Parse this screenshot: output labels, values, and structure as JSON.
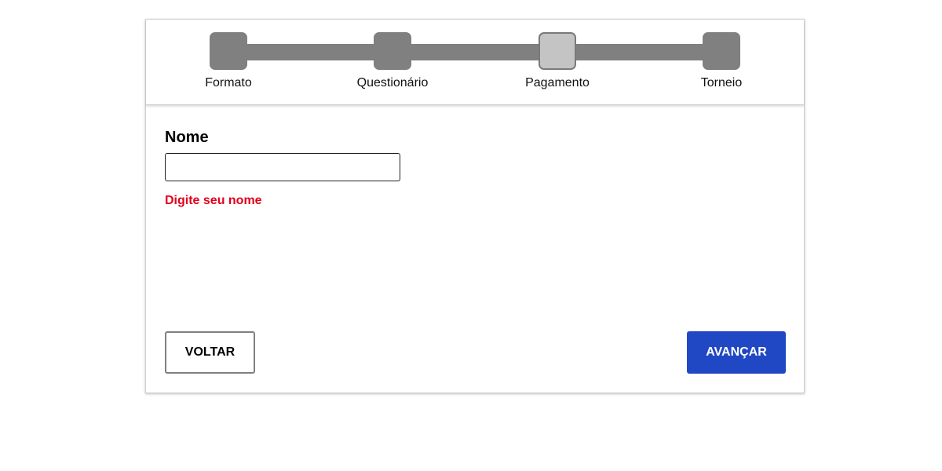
{
  "stepper": {
    "steps": [
      {
        "label": "Formato",
        "state": "done"
      },
      {
        "label": "Questionário",
        "state": "done"
      },
      {
        "label": "Pagamento",
        "state": "current"
      },
      {
        "label": "Torneio",
        "state": "pending"
      }
    ]
  },
  "form": {
    "name_label": "Nome",
    "name_value": "",
    "name_error": "Digite seu nome"
  },
  "actions": {
    "back_label": "VOLTAR",
    "next_label": "AVANÇAR"
  },
  "colors": {
    "step": "#808080",
    "step_active": "#c4c4c4",
    "error": "#e3001b",
    "primary": "#2148c4"
  }
}
